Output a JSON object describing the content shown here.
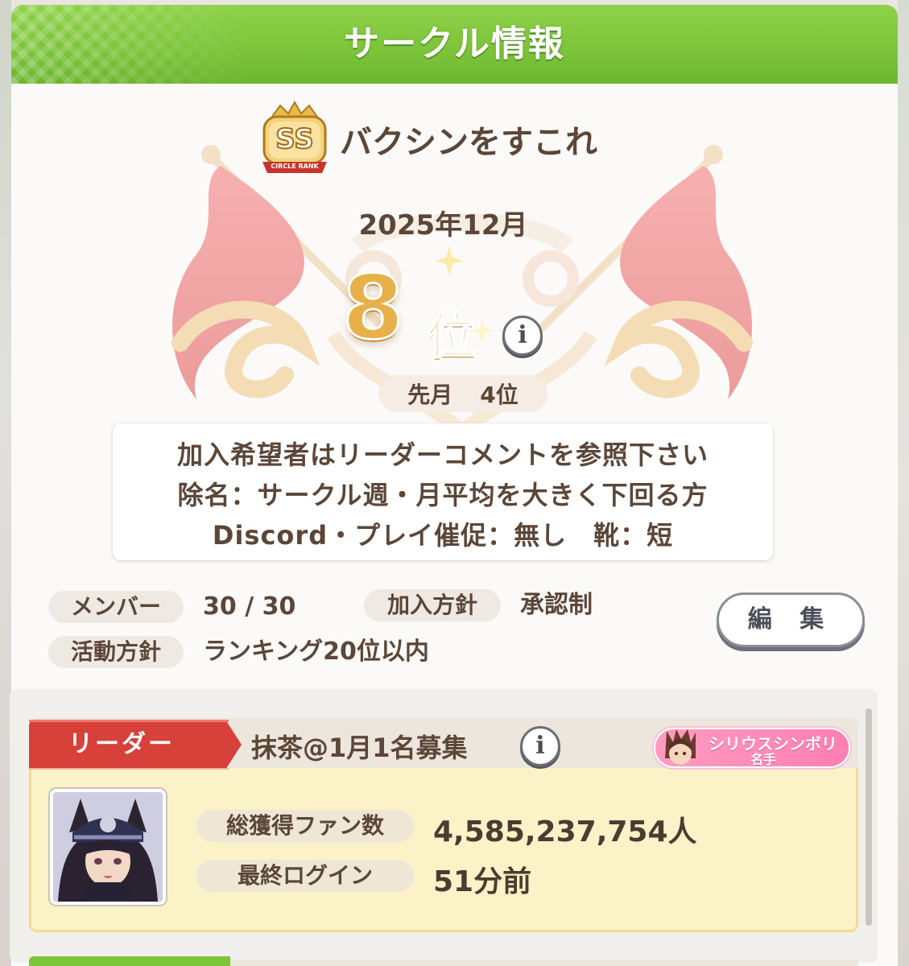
{
  "header": {
    "title": "サークル情報"
  },
  "circle": {
    "rank_badge": {
      "main": "SS",
      "sub": "CIRCLE RANK"
    },
    "name": "バクシンをすこれ",
    "ranking_month": "2025年12月",
    "rank_number": "8",
    "rank_suffix": "位",
    "prev_label": "先月",
    "prev_value": "4位",
    "comment_lines": [
      "加入希望者はリーダーコメントを参照下さい",
      "除名：サークル週・月平均を大きく下回る方",
      "Discord・プレイ催促：無し　靴：短"
    ],
    "members_label": "メンバー",
    "members_value": "30 / 30",
    "join_policy_label": "加入方針",
    "join_policy_value": "承認制",
    "activity_label": "活動方針",
    "activity_value": "ランキング20位以内",
    "edit_button": "編 集",
    "info_icon_glyph": "i"
  },
  "leader": {
    "role_label": "リーダー",
    "name": "抹茶@1月1名募集",
    "title_badge_line1": "シリウスシンボリ",
    "title_badge_line2": "名手",
    "fans_label": "総獲得ファン数",
    "fans_value": "4,585,237,754人",
    "last_login_label": "最終ログイン",
    "last_login_value": "51分前"
  },
  "colors": {
    "header_green": "#7cc43a",
    "rank_gold": "#e7b04b",
    "leader_red": "#d8403a",
    "card_yellow": "#fbf2c8",
    "title_pink": "#ff8fba"
  },
  "icons": [
    "info-icon",
    "rank-badge-icon",
    "flag-emblem-icon",
    "sparkle-icon",
    "avatar-image"
  ]
}
